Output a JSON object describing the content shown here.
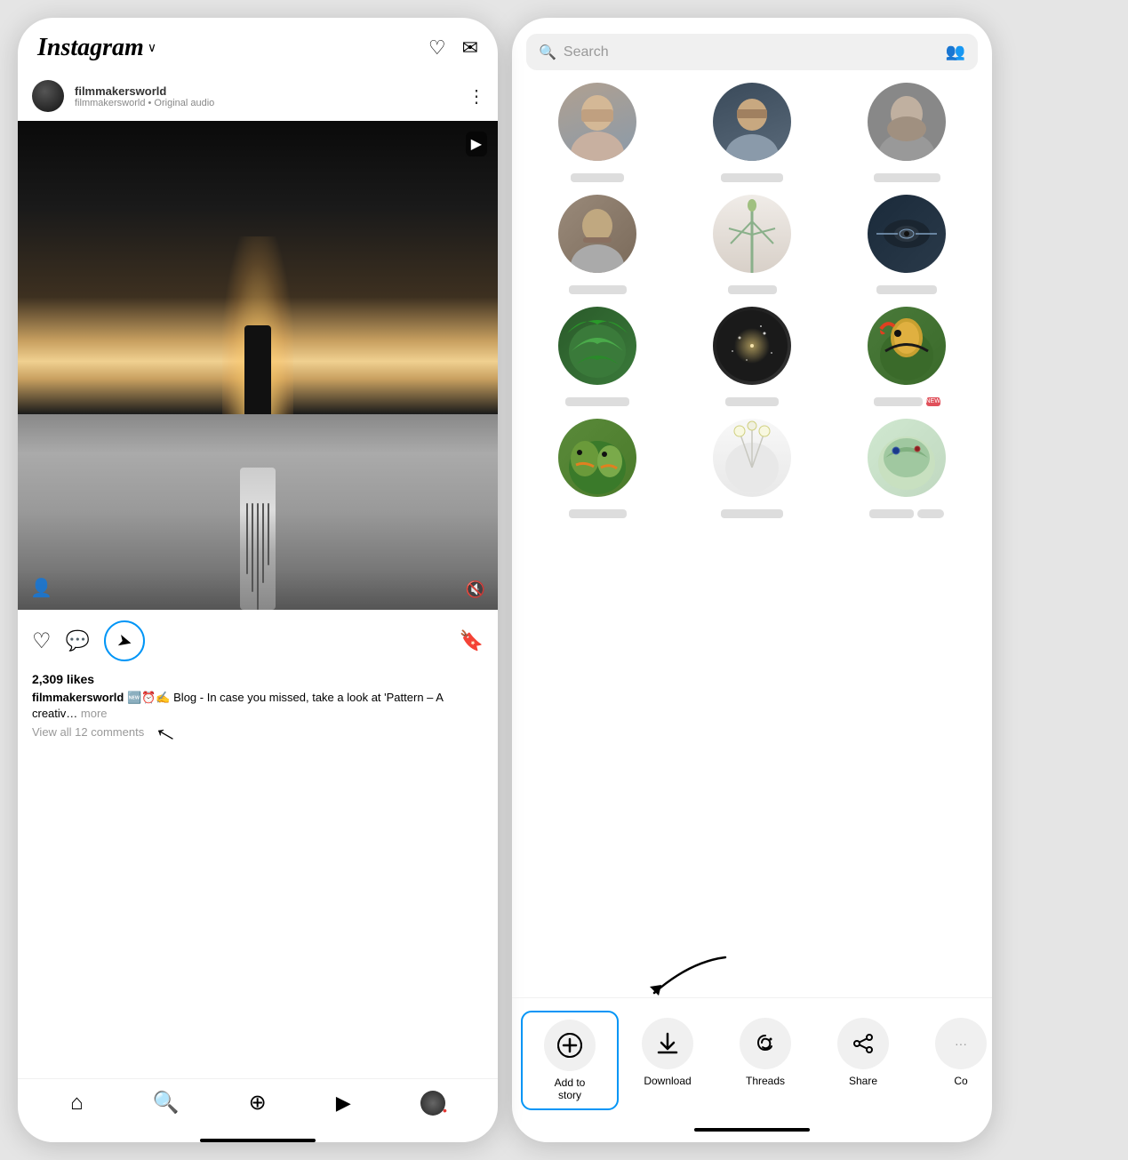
{
  "left_phone": {
    "header": {
      "logo": "Instagram",
      "chevron": "∨",
      "heart_icon": "♡",
      "messenger_icon": "✉"
    },
    "post": {
      "username": "filmmakersworld",
      "subtitle": "filmmakersworld • Original audio",
      "more_icon": "⋮",
      "video_badge": "▶",
      "likes": "2,309 likes",
      "caption_username": "filmmakersworld",
      "caption_emojis": "🆕⏰✍️",
      "caption_text": " Blog - In case you missed, take a look at 'Pattern – A creativ…",
      "more_label": "more",
      "view_comments": "View all 12 comments"
    },
    "actions": {
      "heart": "♡",
      "comment": "💬",
      "send": "➤",
      "bookmark": "🔖"
    },
    "nav": {
      "home": "⌂",
      "search": "🔍",
      "add": "⊕",
      "reels": "▶",
      "profile": "👤"
    }
  },
  "right_phone": {
    "search": {
      "placeholder": "Search",
      "search_icon": "🔍",
      "add_people_icon": "👥+"
    },
    "share_actions": [
      {
        "icon": "⊕",
        "label": "Add to story",
        "highlighted": true
      },
      {
        "icon": "⬇",
        "label": "Download",
        "highlighted": false
      },
      {
        "icon": "Ⓣ",
        "label": "Threads",
        "highlighted": false
      },
      {
        "icon": "⬆",
        "label": "Share",
        "highlighted": false
      },
      {
        "icon": "…",
        "label": "Co",
        "highlighted": false
      }
    ],
    "contacts": [
      [
        {
          "color": "av-man1",
          "emoji": "👨"
        },
        {
          "color": "av-man2",
          "emoji": "👨‍🦱"
        },
        {
          "color": "av-man3",
          "emoji": "🧔"
        }
      ],
      [
        {
          "color": "av-beard",
          "emoji": "🧔"
        },
        {
          "color": "av-palm",
          "emoji": "🌴"
        },
        {
          "color": "av-eye",
          "emoji": "👁️"
        }
      ],
      [
        {
          "color": "av-leaf",
          "emoji": "🌿"
        },
        {
          "color": "av-sparkle",
          "emoji": "✨"
        },
        {
          "color": "av-toucan",
          "emoji": "🦜"
        }
      ],
      [
        {
          "color": "av-parrot",
          "emoji": "🦜"
        },
        {
          "color": "av-flower",
          "emoji": "🌸"
        },
        {
          "color": "av-butterfly",
          "emoji": "🦋"
        }
      ]
    ]
  }
}
